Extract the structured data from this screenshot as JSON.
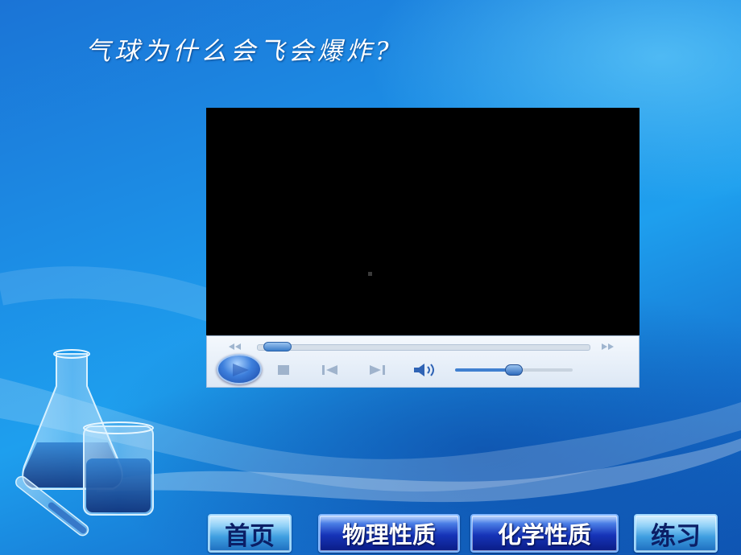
{
  "slide": {
    "title": "气球为什么会飞会爆炸?"
  },
  "player": {
    "play_icon": "play-icon",
    "stop_icon": "stop-icon",
    "prev_icon": "previous-track-icon",
    "next_icon": "next-track-icon",
    "volume_icon": "speaker-icon",
    "seek_back_icon": "rewind-icon",
    "seek_forward_icon": "fast-forward-icon",
    "progress_fraction": 0.02,
    "volume_fraction": 0.5
  },
  "nav": {
    "home": "首页",
    "physical": "物理性质",
    "chemical": "化学性质",
    "practice": "练习"
  },
  "colors": {
    "background": "#1c8fe6",
    "player_accent": "#3f7fd0",
    "nav_light": "#8fd0f7",
    "nav_dark": "#1634b8"
  }
}
